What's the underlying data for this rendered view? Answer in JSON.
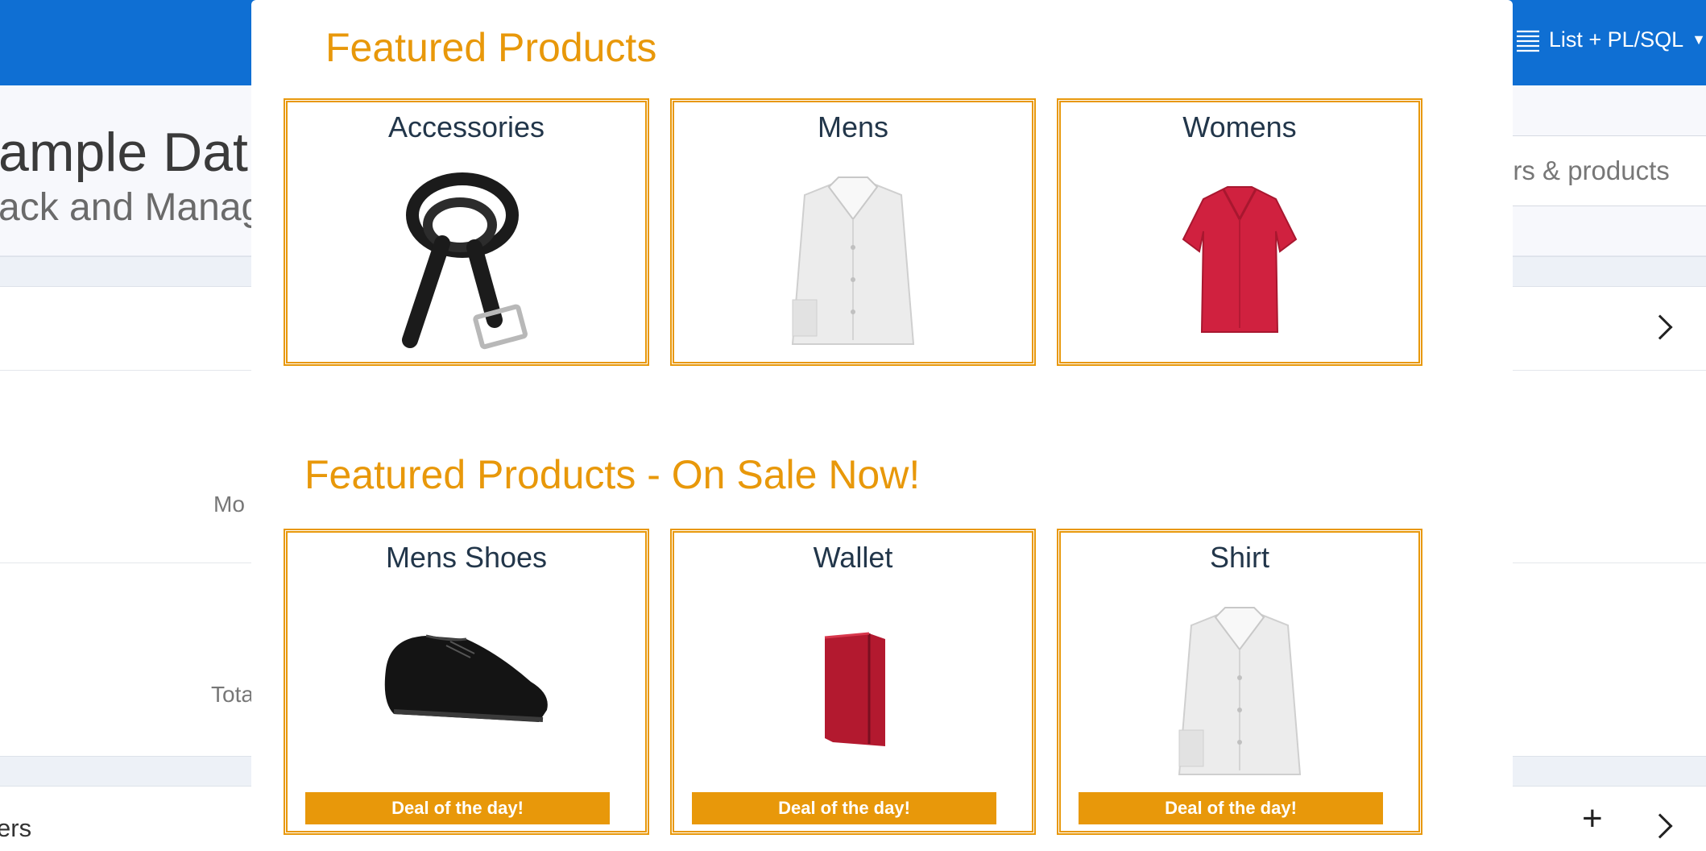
{
  "background": {
    "nav_menu_label": "List + PL/SQL",
    "nav_menu_icon": "list-icon",
    "page_title": "ample Dat",
    "page_subtitle": "ack and Manag",
    "search_text": "ers & products",
    "row_label_1": "Mo",
    "row_label_2": "Tota",
    "bottom_label": "ers",
    "add_symbol": "+"
  },
  "modal": {
    "section1_title": "Featured Products",
    "section2_title": "Featured Products - On Sale Now!",
    "featured": [
      {
        "label": "Accessories",
        "icon": "belt-image"
      },
      {
        "label": "Mens",
        "icon": "white-shirt-image"
      },
      {
        "label": "Womens",
        "icon": "red-blouse-image"
      }
    ],
    "on_sale": [
      {
        "label": "Mens Shoes",
        "icon": "shoe-image",
        "badge": "Deal of the day!"
      },
      {
        "label": "Wallet",
        "icon": "wallet-image",
        "badge": "Deal of the day!"
      },
      {
        "label": "Shirt",
        "icon": "white-shirt-image",
        "badge": "Deal of the day!"
      }
    ]
  },
  "colors": {
    "accent": "#e8980a",
    "topbar": "#0f6fd3",
    "card_title": "#22364a"
  }
}
